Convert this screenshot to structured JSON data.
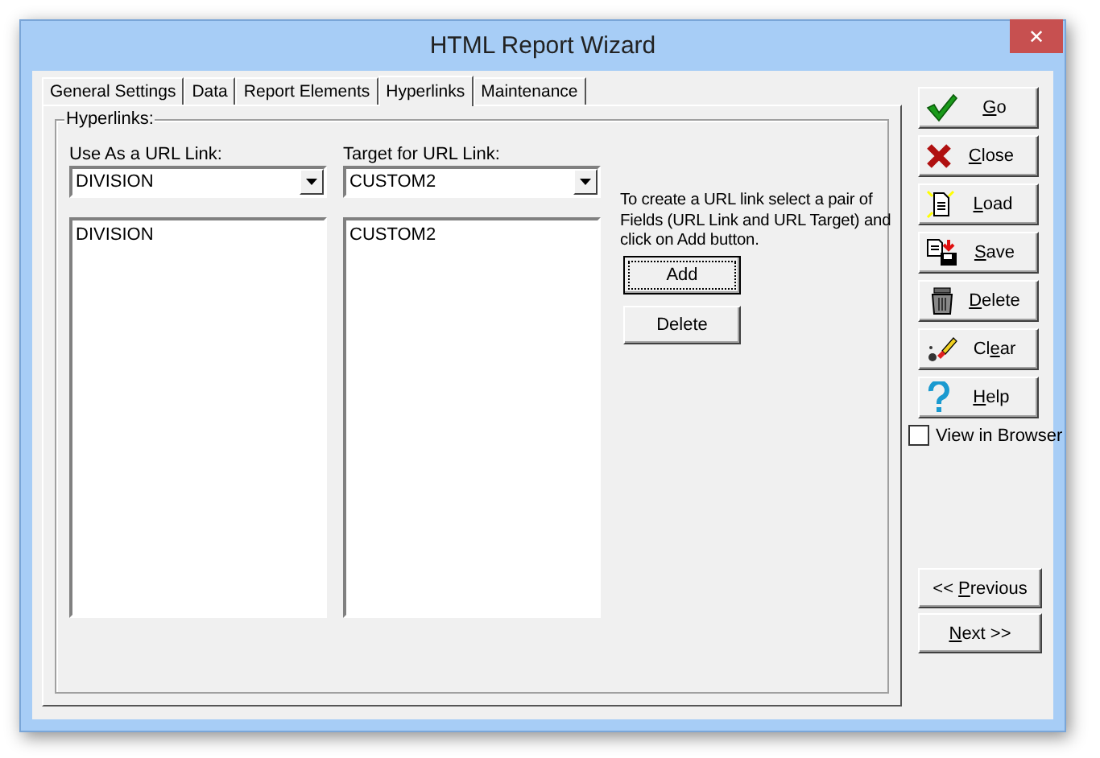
{
  "window": {
    "title": "HTML Report Wizard",
    "close": "✕"
  },
  "tabs": [
    {
      "label": "General Settings",
      "selected": false
    },
    {
      "label": "Data",
      "selected": false
    },
    {
      "label": "Report Elements",
      "selected": false
    },
    {
      "label": "Hyperlinks",
      "selected": true
    },
    {
      "label": "Maintenance",
      "selected": false
    }
  ],
  "group": {
    "title": "Hyperlinks:",
    "link_field": {
      "label": "Use As a URL Link:",
      "value": "DIVISION",
      "items": [
        "DIVISION"
      ]
    },
    "target_field": {
      "label": "Target for URL Link:",
      "value": "CUSTOM2",
      "items": [
        "CUSTOM2"
      ]
    },
    "instructions": "To create a URL link select a pair of Fields (URL Link and URL Target) and click on Add button.",
    "buttons": [
      {
        "label": "Add",
        "focused": true
      },
      {
        "label": "Delete",
        "focused": false
      }
    ]
  },
  "actions": [
    {
      "kind": "go",
      "key": "G",
      "post": "o"
    },
    {
      "kind": "close",
      "key": "C",
      "post": "lose"
    },
    {
      "kind": "load",
      "key": "L",
      "post": "oad"
    },
    {
      "kind": "save",
      "key": "S",
      "post": "ave"
    },
    {
      "kind": "delete",
      "key": "D",
      "post": "elete"
    },
    {
      "kind": "clear",
      "pre": "Cl",
      "key": "e",
      "post": "ar"
    },
    {
      "kind": "help",
      "key": "H",
      "post": "elp"
    }
  ],
  "view_in_browser": {
    "label": "View in Browser",
    "checked": false
  },
  "nav": [
    {
      "pre": "<< ",
      "key": "P",
      "post": "revious"
    },
    {
      "key": "N",
      "post": "ext >>"
    }
  ]
}
